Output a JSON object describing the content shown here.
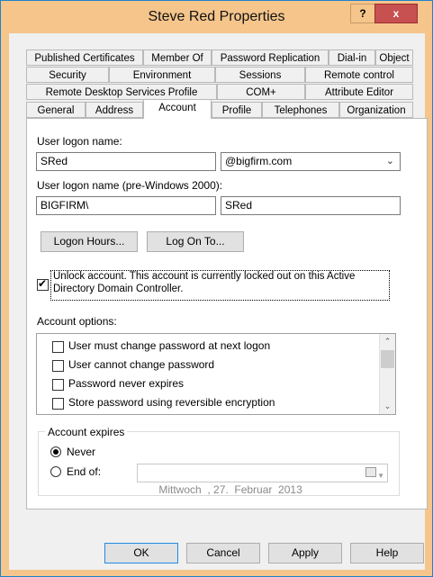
{
  "window": {
    "title": "Steve Red Properties",
    "help_label": "?",
    "close_label": "x"
  },
  "tabs": {
    "row1": [
      "Published Certificates",
      "Member Of",
      "Password Replication",
      "Dial-in",
      "Object"
    ],
    "row2": [
      "Security",
      "Environment",
      "Sessions",
      "Remote control"
    ],
    "row3": [
      "Remote Desktop Services Profile",
      "COM+",
      "Attribute Editor"
    ],
    "row4": [
      "General",
      "Address",
      "Account",
      "Profile",
      "Telephones",
      "Organization"
    ],
    "active": "Account"
  },
  "account": {
    "logon_name_label": "User logon name:",
    "logon_name_value": "SRed",
    "domain_value": "@bigfirm.com",
    "pre2000_label": "User logon name (pre-Windows 2000):",
    "pre2000_domain": "BIGFIRM\\",
    "pre2000_user": "SRed",
    "logon_hours_button": "Logon Hours...",
    "log_on_to_button": "Log On To...",
    "unlock_text_line1": "Unlock account. This account is currently locked out on this Active",
    "unlock_text_line2": "Directory Domain Controller.",
    "unlock_checked": true,
    "options_label": "Account options:",
    "options": [
      {
        "label": "User must change password at next logon",
        "checked": false
      },
      {
        "label": "User cannot change password",
        "checked": false
      },
      {
        "label": "Password never expires",
        "checked": false
      },
      {
        "label": "Store password using reversible encryption",
        "checked": false
      }
    ],
    "expires_label": "Account expires",
    "never_label": "Never",
    "end_of_label": "End of:",
    "end_of_date": "Mittwoch  , 27.  Februar  2013",
    "expires_selected": "Never"
  },
  "buttons": {
    "ok": "OK",
    "cancel": "Cancel",
    "apply": "Apply",
    "help": "Help"
  }
}
